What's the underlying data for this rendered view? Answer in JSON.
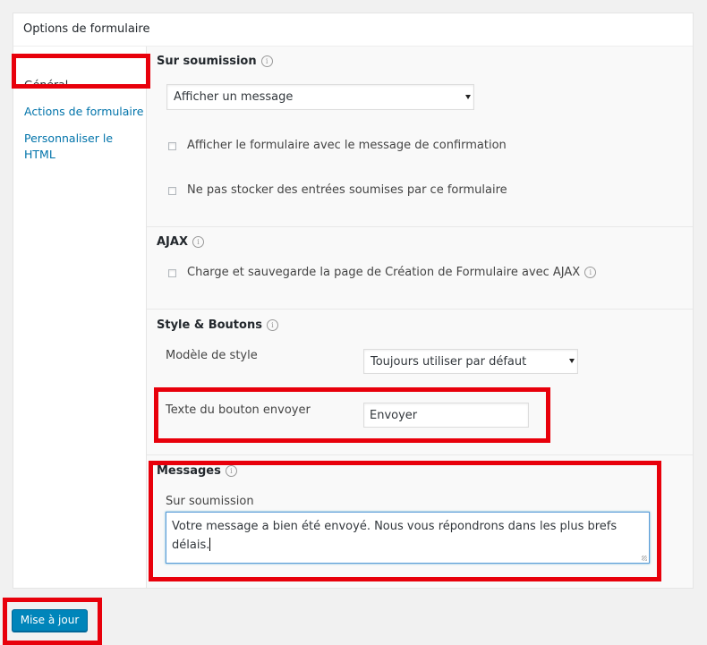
{
  "panel": {
    "title": "Options de formulaire"
  },
  "sidebar": {
    "items": [
      {
        "label": "Général",
        "active": true
      },
      {
        "label": "Actions de formulaire",
        "active": false
      },
      {
        "label": "Personnaliser le HTML",
        "active": false
      }
    ]
  },
  "submission": {
    "heading": "Sur soumission",
    "action_value": "Afficher un message",
    "checkbox_show_form": "Afficher le formulaire avec le message de confirmation",
    "checkbox_no_store": "Ne pas stocker des entrées soumises par ce formulaire"
  },
  "ajax": {
    "heading": "AJAX",
    "checkbox_ajax": "Charge et sauvegarde la page de Création de Formulaire avec AJAX"
  },
  "style": {
    "heading": "Style & Boutons",
    "style_label": "Modèle de style",
    "style_value": "Toujours utiliser par défaut",
    "button_text_label": "Texte du bouton envoyer",
    "button_text_value": "Envoyer"
  },
  "messages": {
    "heading": "Messages",
    "on_submit_label": "Sur soumission",
    "on_submit_value": "Votre message a bien été envoyé. Nous vous répondrons dans les plus brefs délais."
  },
  "footer": {
    "update_button": "Mise à jour"
  },
  "icons": {
    "info": "info-circle-icon",
    "dropdown": "chevron-down-icon"
  },
  "colors": {
    "highlight": "#e8000b",
    "primary": "#0085ba",
    "link": "#0073aa"
  }
}
